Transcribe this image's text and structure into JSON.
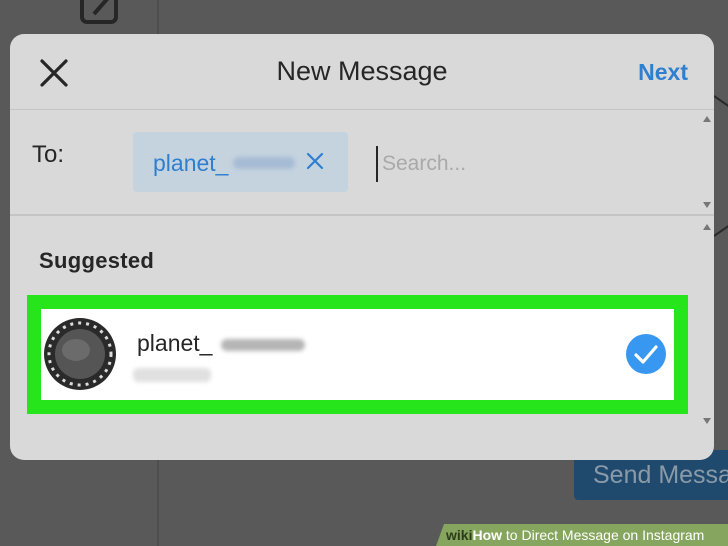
{
  "background": {
    "send_button_label": "Send Message"
  },
  "modal": {
    "title": "New Message",
    "next_label": "Next",
    "to_label": "To:",
    "recipient_chip": {
      "username": "planet_"
    },
    "search": {
      "placeholder": "Search..."
    },
    "suggested_heading": "Suggested",
    "suggestions": [
      {
        "username": "planet_",
        "selected": true
      }
    ]
  },
  "colors": {
    "accent": "#2f7fcf",
    "highlight": "#26e51a",
    "check": "#3897f0"
  },
  "watermark": {
    "brand": "wiki",
    "how": "How",
    "rest": " to Direct Message on Instagram"
  }
}
